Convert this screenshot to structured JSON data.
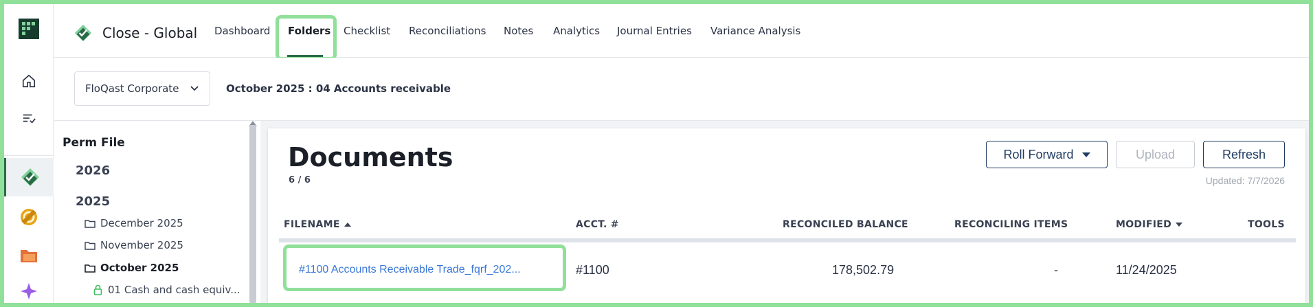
{
  "app": {
    "title": "Close - Global"
  },
  "nav": {
    "tabs": [
      {
        "label": "Dashboard"
      },
      {
        "label": "Folders",
        "active": true
      },
      {
        "label": "Checklist"
      },
      {
        "label": "Reconciliations"
      },
      {
        "label": "Notes"
      },
      {
        "label": "Analytics"
      },
      {
        "label": "Journal Entries"
      },
      {
        "label": "Variance Analysis"
      }
    ]
  },
  "rail": {
    "icons": [
      "app-logo-icon",
      "home-icon",
      "task-list-icon",
      "close-checkmark-icon",
      "coin-icon",
      "folder-icon",
      "sparkle-icon"
    ]
  },
  "subheader": {
    "entity": "FloQast Corporate",
    "period_path": "October 2025 : 04 Accounts receivable"
  },
  "tree": {
    "title": "Perm File",
    "years": [
      "2026",
      "2025"
    ],
    "months": [
      {
        "label": "December 2025"
      },
      {
        "label": "November 2025"
      },
      {
        "label": "October 2025",
        "active": true
      }
    ],
    "files": [
      {
        "label": "01 Cash and cash equiv..."
      }
    ]
  },
  "documents": {
    "title": "Documents",
    "count": "6 / 6",
    "buttons": {
      "roll_forward": "Roll Forward",
      "upload": "Upload",
      "refresh": "Refresh"
    },
    "updated": "Updated: 7/7/2026",
    "columns": {
      "filename": "FILENAME",
      "acct": "ACCT. #",
      "reconciled_balance": "RECONCILED BALANCE",
      "reconciling_items": "RECONCILING ITEMS",
      "modified": "MODIFIED",
      "tools": "TOOLS"
    },
    "rows": [
      {
        "filename": "#1100 Accounts Receivable Trade_fqrf_202...",
        "acct": "#1100",
        "reconciled_balance": "178,502.79",
        "reconciling_items": "-",
        "modified": "11/24/2025"
      }
    ]
  },
  "colors": {
    "highlight": "#90e09a",
    "accent_green": "#2a6b47",
    "link_blue": "#3b78d8",
    "button_navy": "#1f3b63"
  }
}
